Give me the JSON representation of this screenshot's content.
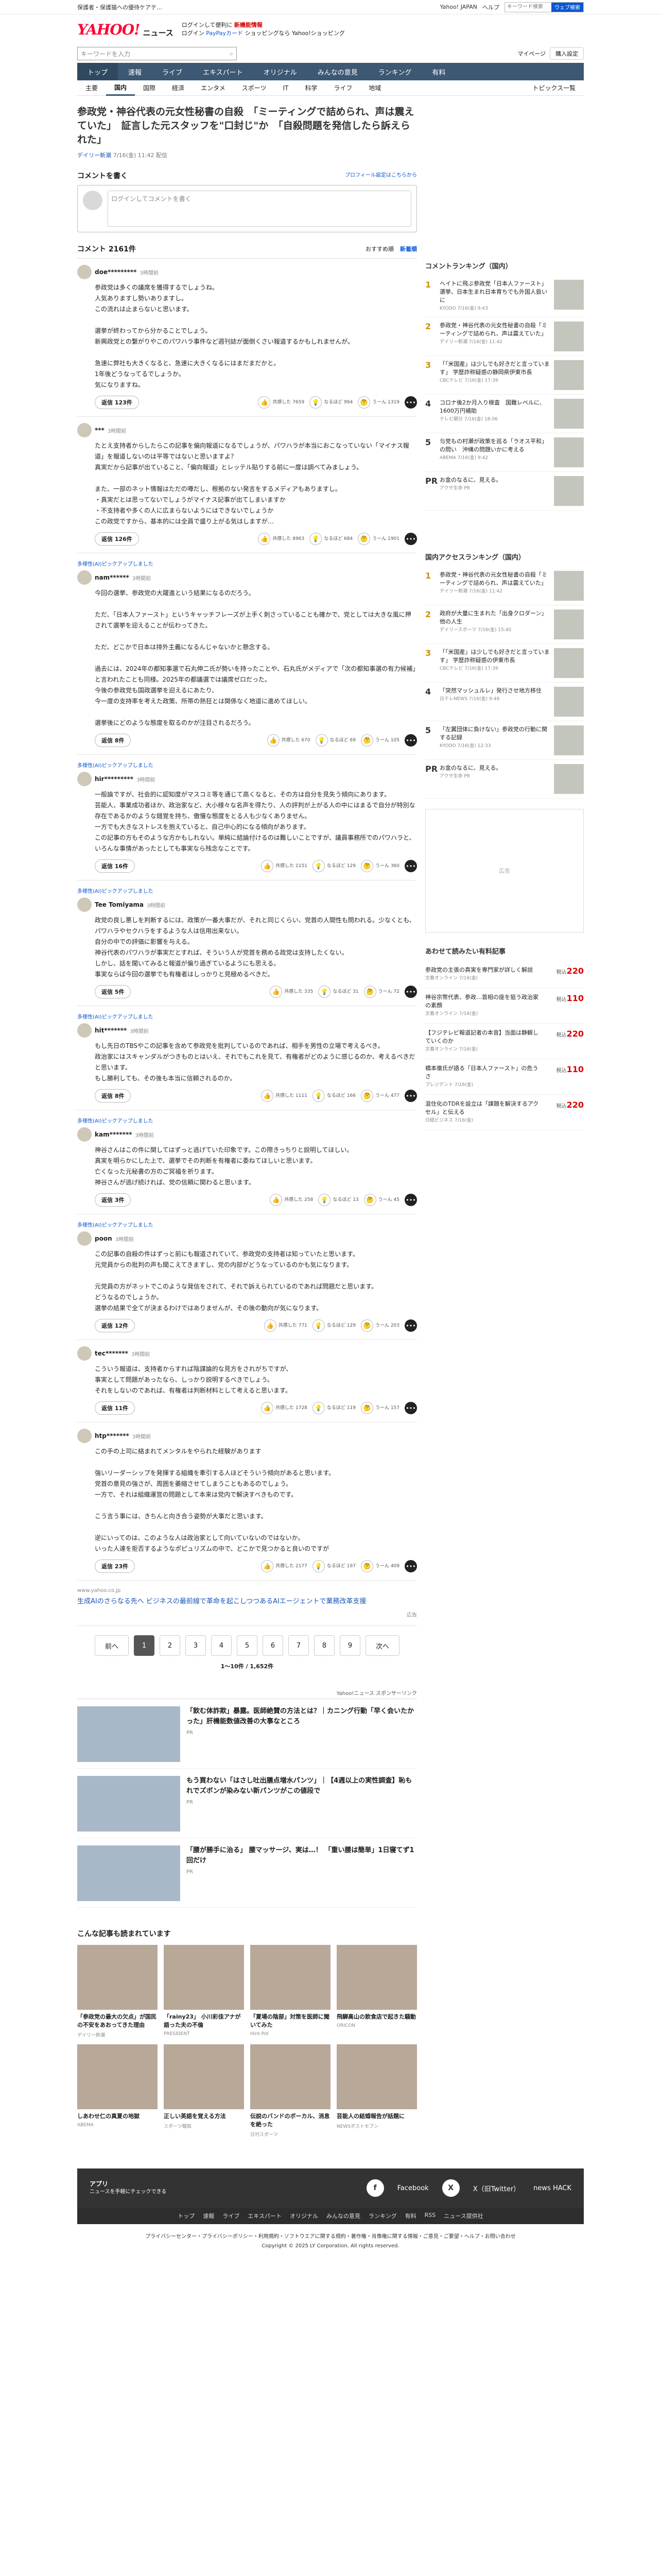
{
  "topbar": {
    "notice": "保護者・保護猫への優待ケアテ…",
    "yahoo_japan": "Yahoo! JAPAN",
    "help": "ヘルプ",
    "search_placeholder": "キーワード検索",
    "web_search": "ウェブ検索"
  },
  "header": {
    "logo": "YAHOO!",
    "logo_sub": "ニュース",
    "promo_line1": "ログインして便利に",
    "promo_bold": "新機能情報",
    "promo_line2": "ログイン",
    "promo_blue": "PayPayカード",
    "promo_line3": "ショッピングなら Yahoo!ショッピング"
  },
  "search": {
    "placeholder": "キーワードを入力",
    "mypage": "マイページ",
    "start": "購入設定"
  },
  "global_nav": [
    "トップ",
    "速報",
    "ライブ",
    "エキスパート",
    "オリジナル",
    "みんなの意見",
    "ランキング",
    "有料"
  ],
  "sub_nav": [
    "主要",
    "国内",
    "国際",
    "経済",
    "エンタメ",
    "スポーツ",
    "IT",
    "科学",
    "ライフ",
    "地域"
  ],
  "sub_nav_topics": "トピックス一覧",
  "article": {
    "title": "参政党・神谷代表の元女性秘書の自殺　「ミーティングで詰められ、声は震えていた」　証言した元スタッフを\"口封じ\"か　「自殺問題を発信したら訴えられた」",
    "source": "デイリー新潮",
    "time": "7/16(金) 11:42 配信"
  },
  "comment_form": {
    "title": "コメントを書く",
    "profile_link": "プロフィール設定はこちらから",
    "placeholder": "ログインしてコメントを書く"
  },
  "comments_header": {
    "count": "コメント 2161件",
    "sort1": "おすすめ順",
    "sort2": "新着順"
  },
  "comments": [
    {
      "tag": "",
      "name": "doe*********",
      "time": "3時間前",
      "body": "参政党は多くの議席を獲得するでしょうね。\n人気ありますし勢いありますし。\nこの流れは止まらないと思います。\n\n選挙が終わってから分かることでしょう。\n新興政党との繋がりやこのパワハラ事件など週刊誌が面倒くさい報道するかもしれませんが。\n\n急速に弊社も大きくなると、急速に大きくなるにはまだまだかと。\n1年後どうなってるでしょうか。\n気になりますね。",
      "reply": "返信 123件",
      "r1": "共感した 7659",
      "r2": "なるほど 994",
      "r3": "うーん 1319"
    },
    {
      "tag": "",
      "name": "***",
      "time": "3時間前",
      "body": "たとえ支持者からしたらこの記事を偏向報道になるでしょうが、パワハラが本当におこなっていない「マイナス報道」を報道しないのは平等ではないと思いますよ？\n真実だから記事が出ていること、「偏向報道」とレッテル貼りする前に一度は調べてみましょう。\n\nまた、一部のネット情報はただの噂だし、根拠のない発言をするメディアもありますし。\n・真実だとは思ってないでしょうがマイナス記事が出てしまいますか\n・不支持者や多くの人に広まらないようにはできないでしょうか\nこの政党ですから、基本的には全員で盛り上がる気はしますが…",
      "reply": "返信 126件",
      "r1": "共感した 8963",
      "r2": "なるほど 684",
      "r3": "うーん 1901"
    },
    {
      "tag": "多様性(AI)ピックアップしました",
      "name": "nam******",
      "time": "3時間前",
      "body": "今回の選挙、参政党の大躍進という結果になるのだろう。\n\nただ、「日本人ファースト」というキャッチフレーズが上手く刺さっていることも確かで、党としては大きな風に押されて選挙を迎えることが伝わってきた。\n\nただ、どこかで日本は排外主義になるんじゃないかと懸念する。\n\n過去には、2024年の都知事選で石丸伸二氏が勢いを持ったことや、石丸氏がメディアで「次の都知事選の有力候補」と言われたことも同様。2025年の都議選では議席ゼロだった。\n今後の参政党も国政選挙を迎えるにあたり、\n今一度の支持率を考えた政策、所帯の熱狂とは関係なく地道に進めてほしい。\n\n選挙後にどのような態度を取るのかが注目されるだろう。",
      "reply": "返信 8件",
      "r1": "共感した 670",
      "r2": "なるほど 69",
      "r3": "うーん 105"
    },
    {
      "tag": "多様性(AI)ピックアップしました",
      "name": "hir*********",
      "time": "3時間前",
      "body": "一般論ですが、社会的に認知度がマスコミ等を通じて高くなると、その方は自分を見失う傾向にあります。\n芸能人、事業成功者ほか、政治家など、大小様々な名声を得たり、人の評判が上がる人の中にはまるで自分が特別な存在であるかのような錯覚を持ち、傲慢な態度をとる人も少なくありません。\n一方でも大きなストレスを抱えていると、自己中心的になる傾向があります。\nこの記事の方もそのような方かもしれない。単純に結論付けるのは難しいことですが、議員事務所でのパワハラと、いろんな事情があったとしても事実なら残念なことです。",
      "reply": "返信 16件",
      "r1": "共感した 1151",
      "r2": "なるほど 129",
      "r3": "うーん 360"
    },
    {
      "tag": "多様性(AI)ピックアップしました",
      "name": "Tee Tomiyama",
      "time": "3時間前",
      "body": "政党の良し悪しを判断するには、政策が一番大事だが、それと同じくらい、党首の人間性も問われる。少なくとも、パワハラやセクハラをするような人は信用出来ない。\n自分の中での評価に影響を与える。\n神谷代表のパワハラが事実だとすれば、そういう人が党首を務める政党は支持したくない。\nしかし、話を聞いてみると報道が偏り過ぎているようにも思える。\n事実ならば今回の選挙でも有権者はしっかりと見極めるべきだ。",
      "reply": "返信 5件",
      "r1": "共感した 335",
      "r2": "なるほど 31",
      "r3": "うーん 72"
    },
    {
      "tag": "多様性(AI)ピックアップしました",
      "name": "hit*******",
      "time": "3時間前",
      "body": "もし先日のTBSやこの記事を含めて参政党を批判しているのであれば、相手を男性の立場で考えるべき。\n政治家にはスキャンダルがつきものとはいえ、それでもこれを見て、有権者がどのように感じるのか、考えるべきだと思います。\nもし勝利しても、その後も本当に信頼されるのか。",
      "reply": "返信 8件",
      "r1": "共感した 1111",
      "r2": "なるほど 166",
      "r3": "うーん 477"
    },
    {
      "tag": "多様性(AI)ピックアップしました",
      "name": "kam*******",
      "time": "3時間前",
      "body": "神谷さんはこの件に関してはずっと逃げていた印象です。この際きっちりと説明してほしい。\n真実を明らかにした上で、選挙でその判断を有権者に委ねてほしいと思います。\n亡くなった元秘書の方のご冥福を祈ります。\n神谷さんが逃げ続ければ、党の信頼に関わると思います。",
      "reply": "返信 3件",
      "r1": "共感した 258",
      "r2": "なるほど 13",
      "r3": "うーん 45"
    },
    {
      "tag": "多様性(AI)ピックアップしました",
      "name": "poon",
      "time": "3時間前",
      "body": "この記事の自殺の件はずっと前にも報道されていて、参政党の支持者は知っていたと思います。\n元党員からの批判の声も聞こえてきますし、党の内部がどうなっているのかも気になります。\n\n元党員の方がネットでこのような発信をされて、それで訴えられているのであれば問題だと思います。\nどうなるのでしょうか。\n選挙の結果で全てが決まるわけではありませんが、その後の動向が気になります。",
      "reply": "返信 12件",
      "r1": "共感した 771",
      "r2": "なるほど 129",
      "r3": "うーん 203"
    },
    {
      "tag": "",
      "name": "tec*******",
      "time": "3時間前",
      "body": "こういう報道は、支持者からすれば陰謀論的な見方をされがちですが、\n事実として問題があったなら、しっかり説明するべきでしょう。\nそれをしないのであれば、有権者は判断材料として考えると思います。",
      "reply": "返信 11件",
      "r1": "共感した 1728",
      "r2": "なるほど 119",
      "r3": "うーん 157"
    },
    {
      "tag": "",
      "name": "htp*******",
      "time": "3時間前",
      "body": "この手の上司に絡まれてメンタルをやられた経験があります\n\n強いリーダーシップを発揮する組織を牽引する人ほどそういう傾向があると思います。\n党首の意見の強さが、周囲を萎縮させてしまうこともあるのでしょう。\n一方で、それは組織運営の問題として本来は党内で解決すべきものです。\n\nこう言う事には、きちんと向き合う姿勢が大事だと思います。\n\n逆にいってのは、このような人は政治家として向いていないのではないか。\nいった人達を拒否するようなポピュリズムの中で、どこかで見つかると良いのですが",
      "reply": "返信 23件",
      "r1": "共感した 2177",
      "r2": "なるほど 197",
      "r3": "うーん 409"
    }
  ],
  "promo": {
    "url": "www.yahoo.co.jp",
    "text": "生成AIのさらなる先へ ビジネスの最前線で革命を起こしつつあるAIエージェントで業務改革支援",
    "label": "広告"
  },
  "pager": {
    "prev": "前へ",
    "pages": [
      "1",
      "2",
      "3",
      "4",
      "5",
      "6",
      "7",
      "8",
      "9"
    ],
    "next": "次へ",
    "info": "1〜10件 / 1,652件"
  },
  "ads_label": "Yahoo!ニュース スポンサーリンク",
  "ads": [
    {
      "title": "「飲む体詐欺」暴露。医師絶賛の方法とは？｜カニング行動「早く会いたかった」肝機能数値改善の大事なところ",
      "sponsor": "PR"
    },
    {
      "title": "もう買わない「はさし吐出膳点増水パンツ」｜【4週以上の実性調査】恥もれでズボンが染みない新パンツがこの値段で",
      "sponsor": "PR"
    },
    {
      "title": "「腰が勝手に治る」 腰マッサージ、実は…！ 「重い腰は簡単」1日寝てず1回だけ",
      "sponsor": "PR"
    }
  ],
  "recommend": {
    "title": "こんな記事も読まれています",
    "cards": [
      {
        "title": "「参政党の最大の欠点」が国民の不安をあおってきた理由",
        "src": "デイリー新潮"
      },
      {
        "title": "「rainy23」 小川彩佳アナが語った夫の不倫",
        "src": "PRESIDENT"
      },
      {
        "title": "「夏場の陰部」対策を医師に聞いてみた",
        "src": "Hint-Pot"
      },
      {
        "title": "飛騨高山の飲食店で起きた騒動",
        "src": "ORICON"
      },
      {
        "title": "しあわせ仁の真夏の地獄",
        "src": "ABEMA"
      },
      {
        "title": "正しい英語を覚える方法",
        "src": "スポーツ報知"
      },
      {
        "title": "伝説のバンドのボーカル、消息を絶った",
        "src": "日刊スポーツ"
      },
      {
        "title": "芸能人の結婚報告が話題に",
        "src": "NEWSポストセブン"
      }
    ]
  },
  "sidebar": {
    "comment_ranking_title": "コメントランキング（国内）",
    "comment_ranking": [
      {
        "no": "1",
        "text": "ヘイトに飛ぶ参政党「日本人ファースト」選挙、日本生まれ日本育ちでも外国人扱いに",
        "meta": "KYODO 7/16(金) 9:43"
      },
      {
        "no": "2",
        "text": "参政党・神谷代表の元女性秘書の自殺「ミーティングで詰められ、声は震えていた」",
        "meta": "デイリー新潮 7/16(金) 11:42"
      },
      {
        "no": "3",
        "text": "「「米国産」は少しでも好きだと言っています」 学歴詐称疑惑の静岡県伊東市長",
        "meta": "CBCテレビ 7/16(金) 17:39"
      },
      {
        "no": "4",
        "text": "コロナ後2か月入り検査　国難レベルに、1600万円補助",
        "meta": "テレビ朝日 7/16(金) 18:06"
      },
      {
        "no": "5",
        "text": "与党もの村瀬が政策を巡る「ラオス平和」の問い　沖縄の問題いかに考える",
        "meta": "ABEMA 7/16(金) 9:42"
      },
      {
        "no": "PR",
        "text": "お金のなるに、見える。",
        "meta": "アクサ生命 PR"
      }
    ],
    "access_ranking_title": "国内アクセスランキング（国内）",
    "access_ranking": [
      {
        "no": "1",
        "text": "参政党・神谷代表の元女性秘書の自殺「ミーティングで詰められ、声は震えていた」",
        "meta": "デイリー新潮 7/16(金) 11:42"
      },
      {
        "no": "2",
        "text": "政府が大量に生まれた「出身クロダーン」他の人生",
        "meta": "デイリースポーツ 7/16(金) 15:40"
      },
      {
        "no": "3",
        "text": "「「米国産」は少しでも好きだと言っています」 学歴詐称疑惑の伊東市長",
        "meta": "CBCテレビ 7/16(金) 17:39"
      },
      {
        "no": "4",
        "text": "「突然マッシュルレ」発行させ地方移住",
        "meta": "日テレNEWS 7/16(金) 9:48"
      },
      {
        "no": "5",
        "text": "「左翼団体に負けない」参政党の行動に関する記録 ",
        "meta": "KYODO 7/16(金) 12:33"
      },
      {
        "no": "PR",
        "text": "お金のなるに、見える。",
        "meta": "アクサ生命 PR"
      }
    ],
    "ad_label": "広告",
    "paid_title": "あわせて読みたい有料記事",
    "paid": [
      {
        "text": "参政党の主張の真実を専門家が詳しく解説",
        "meta": "文春オンライン 7/16(金)",
        "price": "220",
        "unit": "税込"
      },
      {
        "text": "神谷宗幣代表、参政…首相の座を狙う政治家の素顔",
        "meta": "文春オンライン 7/16(金)",
        "price": "110",
        "unit": "税込"
      },
      {
        "text": "【フジテレビ報道記者の本音】当面は静観していくのか",
        "meta": "文春オンライン 7/16(金)",
        "price": "220",
        "unit": "税込"
      },
      {
        "text": "橋本徹氏が語る「日本人ファースト」の危うさ",
        "meta": "プレジデント 7/16(金)",
        "price": "110",
        "unit": "税込"
      },
      {
        "text": "混住化のTDRを設立は「課題を解決するアクセル」と伝える",
        "meta": "日経ビジネス 7/16(金)",
        "price": "220",
        "unit": "税込"
      }
    ]
  },
  "footer": {
    "app_title": "アプリ",
    "app_text": "ニュースを手軽にチェックできる",
    "fb": "Facebook",
    "x": "X（旧Twitter）",
    "hack": "news HACK",
    "links": [
      "トップ",
      "速報",
      "ライブ",
      "エキスパート",
      "オリジナル",
      "みんなの意見",
      "ランキング",
      "有料",
      "RSS",
      "ニュース提供社"
    ],
    "legal": "プライバシーセンター・プライバシーポリシー・利用規約・ソフトウエアに関する規約・著作権・肖像権に関する情報・ご意見・ご要望・ヘルプ・お問い合わせ",
    "copyright": "Copyright © 2025 LY Corporation. All rights reserved."
  }
}
